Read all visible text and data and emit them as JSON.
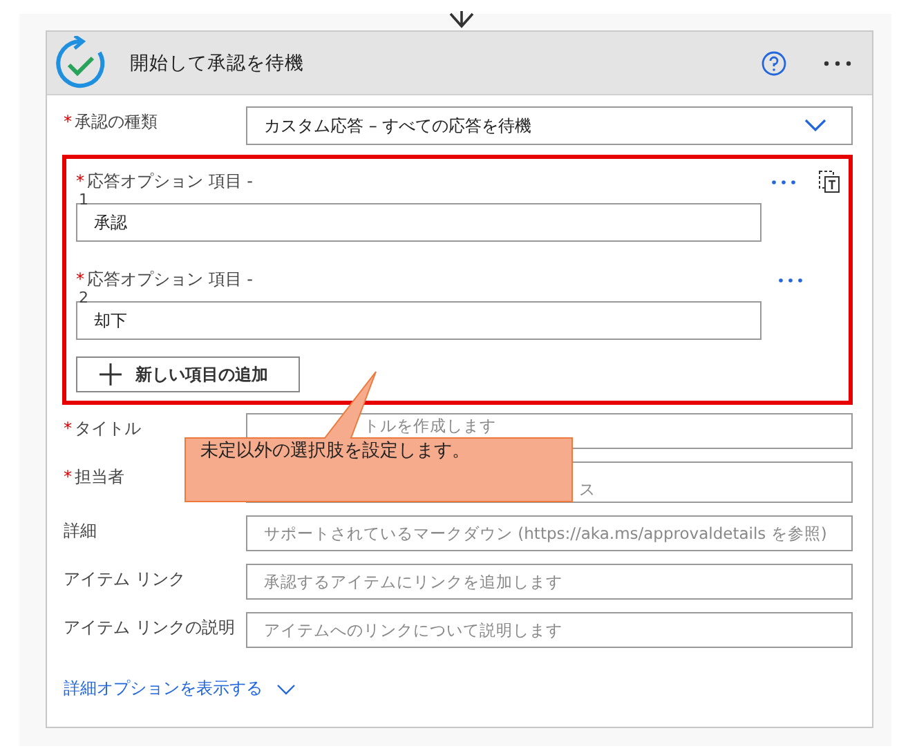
{
  "action": {
    "title": "開始して承認を待機"
  },
  "approval_type": {
    "label": "承認の種類",
    "required_mark": "*",
    "value": "カスタム応答 – すべての応答を待機"
  },
  "response_options": {
    "highlighted": true,
    "items": [
      {
        "required_mark": "*",
        "label": "応答オプション 項目 -",
        "index": "1",
        "value": "承認"
      },
      {
        "required_mark": "*",
        "label": "応答オプション 項目 -",
        "index": "2",
        "value": "却下"
      }
    ],
    "add_button": "新しい項目の追加"
  },
  "fields": [
    {
      "kind": "covered",
      "required_mark": "*",
      "label": "タイトル",
      "placeholder": "トルを作成します"
    },
    {
      "kind": "covered",
      "required_mark": "*",
      "label": "担当者",
      "placeholder": "ス"
    },
    {
      "kind": "text",
      "label": "詳細",
      "placeholder": "サポートされているマークダウン (https://aka.ms/approvaldetails を参照)"
    },
    {
      "kind": "text",
      "label": "アイテム リンク",
      "placeholder": "承認するアイテムにリンクを追加します"
    },
    {
      "kind": "text",
      "label": "アイテム リンクの説明",
      "placeholder": "アイテムへのリンクについて説明します"
    }
  ],
  "advanced_link": "詳細オプションを表示する",
  "callout": {
    "text": "未定以外の選択肢を設定します。"
  }
}
